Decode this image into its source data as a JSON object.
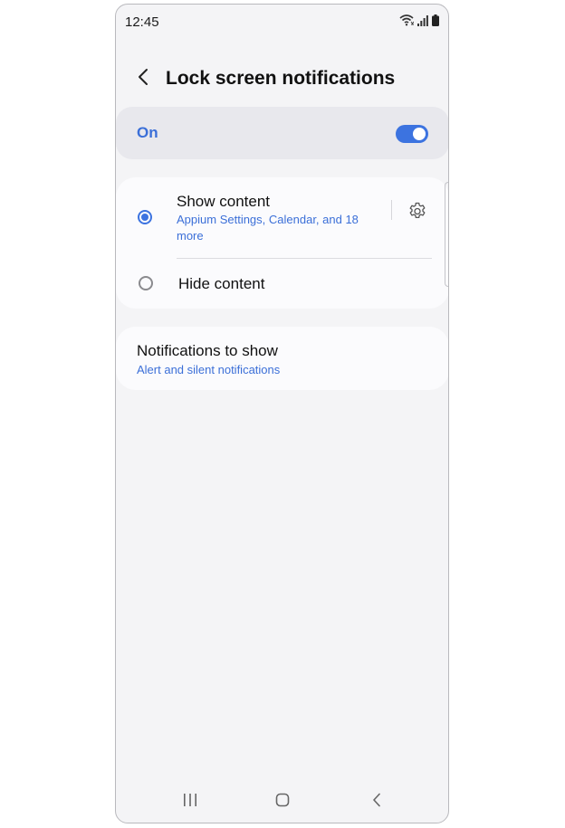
{
  "status_bar": {
    "time": "12:45"
  },
  "header": {
    "title": "Lock screen notifications"
  },
  "master_switch": {
    "label": "On",
    "enabled": true
  },
  "options": [
    {
      "title": "Show content",
      "subtitle": "Appium Settings, Calendar, and 18 more",
      "selected": true
    },
    {
      "title": "Hide content",
      "selected": false
    }
  ],
  "notifications_to_show": {
    "title": "Notifications to show",
    "subtitle": "Alert and silent notifications"
  },
  "colors": {
    "accent": "#3c73e0",
    "background": "#f4f4f6",
    "card": "#fbfbfd"
  },
  "icons": [
    "wifi-icon",
    "signal-icon",
    "battery-icon",
    "back-icon",
    "gear-icon",
    "recents-icon",
    "home-icon",
    "nav-back-icon"
  ]
}
